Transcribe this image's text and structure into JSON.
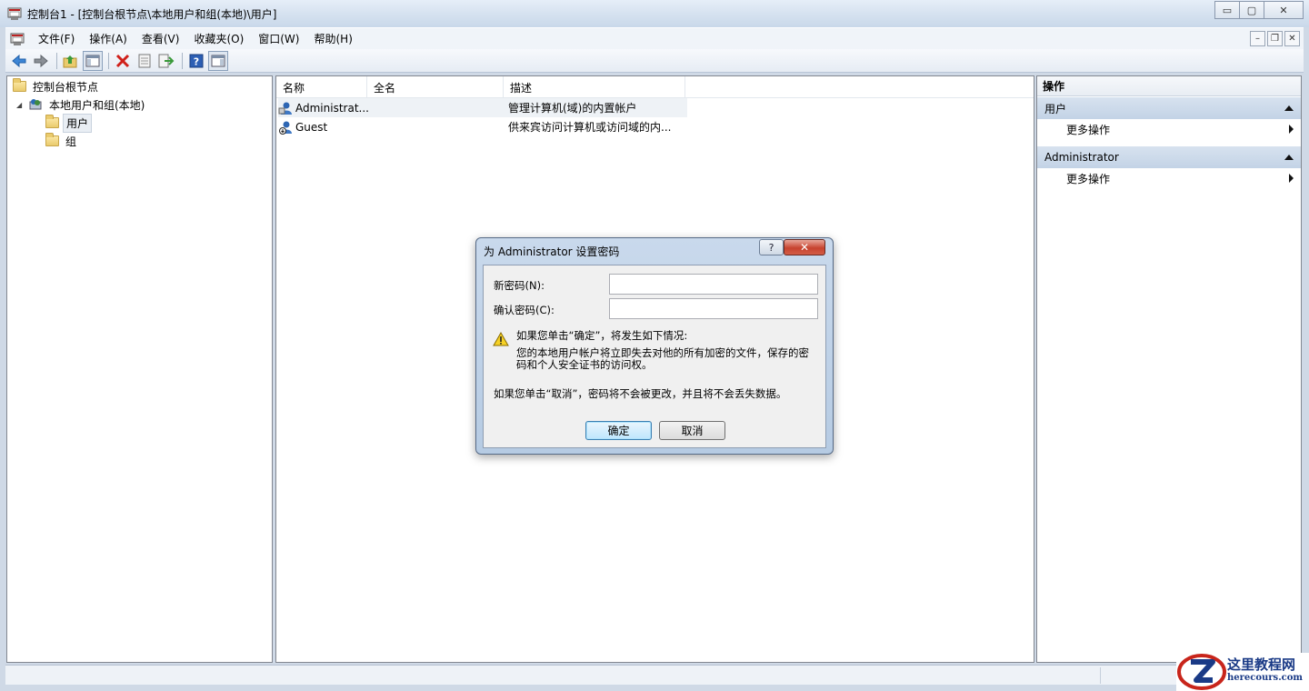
{
  "window": {
    "title": "控制台1 - [控制台根节点\\本地用户和组(本地)\\用户]",
    "buttons": {
      "minimize": "▭",
      "maximize": "▢",
      "close": "✕"
    }
  },
  "menu": {
    "items": [
      "文件(F)",
      "操作(A)",
      "查看(V)",
      "收藏夹(O)",
      "窗口(W)",
      "帮助(H)"
    ],
    "mdi_buttons": {
      "minimize": "–",
      "restore": "❐",
      "close": "✕"
    }
  },
  "toolbar": {
    "buttons": [
      "back-arrow-icon",
      "forward-arrow-icon",
      "up-folder-icon",
      "show-hide-tree-icon",
      "delete-icon",
      "properties-icon",
      "export-list-icon",
      "help-icon",
      "show-hide-action-pane-icon"
    ]
  },
  "tree": {
    "root": "控制台根节点",
    "snapin": "本地用户和组(本地)",
    "children": [
      "用户",
      "组"
    ]
  },
  "list": {
    "columns": [
      "名称",
      "全名",
      "描述"
    ],
    "rows": [
      {
        "name": "Administrat...",
        "fullname": "",
        "description": "管理计算机(域)的内置帐户"
      },
      {
        "name": "Guest",
        "fullname": "",
        "description": "供来宾访问计算机或访问域的内..."
      }
    ]
  },
  "actions": {
    "header": "操作",
    "groups": [
      {
        "title": "用户",
        "items": [
          "更多操作"
        ]
      },
      {
        "title": "Administrator",
        "items": [
          "更多操作"
        ]
      }
    ]
  },
  "dialog": {
    "title": "为 Administrator 设置密码",
    "help_button": "?",
    "close_button": "✕",
    "new_password_label": "新密码(N):",
    "confirm_password_label": "确认密码(C):",
    "new_password_value": "",
    "confirm_password_value": "",
    "warning_line1": "如果您单击“确定”，将发生如下情况:",
    "warning_line2": "您的本地用户帐户将立即失去对他的所有加密的文件，保存的密码和个人安全证书的访问权。",
    "cancel_note": "如果您单击“取消”，密码将不会被更改，并且将不会丢失数据。",
    "ok_button": "确定",
    "cancel_button": "取消"
  },
  "watermark": {
    "text": "这里教程网",
    "url": "herecours.com"
  },
  "colors": {
    "selection": "#e9eef4",
    "action_group": "#c9d8ea",
    "close_red": "#c7432f"
  }
}
